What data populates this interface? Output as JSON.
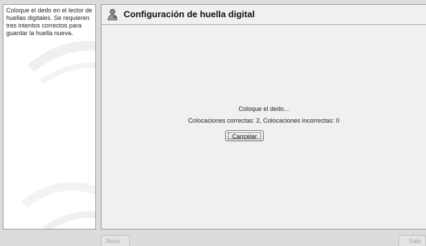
{
  "help": {
    "text": "Coloque el dedo en el lector de huellas digitales. Se requieren tres intentos correctos para guardar la huella nueva."
  },
  "header": {
    "title": "Configuración de huella digital",
    "icon": "fingerprint-user-icon"
  },
  "main": {
    "status": "Coloque el dedo...",
    "counts": "Colocaciones correctas: 2, Colocaciones incorrectas: 0",
    "cancel_label": "Cancelar"
  },
  "footer": {
    "back_label": "Atrás",
    "quit_label": "Salir"
  },
  "colors": {
    "background": "#dcdcdc",
    "panel": "#f0f0f0",
    "help_panel": "#ffffff"
  }
}
